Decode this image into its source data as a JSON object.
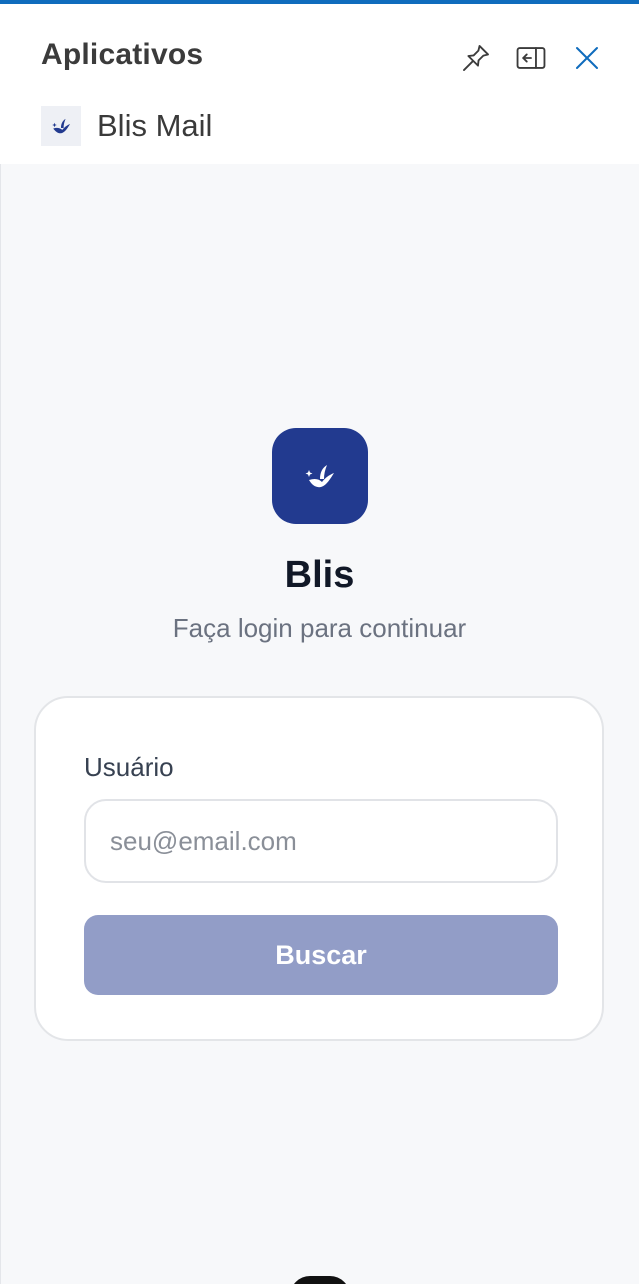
{
  "panel": {
    "title": "Aplicativos",
    "accent_color": "#0f6cbd",
    "actions": [
      "pin-icon",
      "dock-left-icon",
      "close-icon"
    ]
  },
  "app": {
    "name": "Blis Mail",
    "icon": "swallow-logo-icon"
  },
  "login": {
    "brand": "Blis",
    "subtitle": "Faça login para continuar",
    "brand_color": "#223a8f",
    "user_label": "Usuário",
    "user_placeholder": "seu@email.com",
    "user_value": "",
    "submit_label": "Buscar",
    "submit_color": "#929dc7"
  }
}
